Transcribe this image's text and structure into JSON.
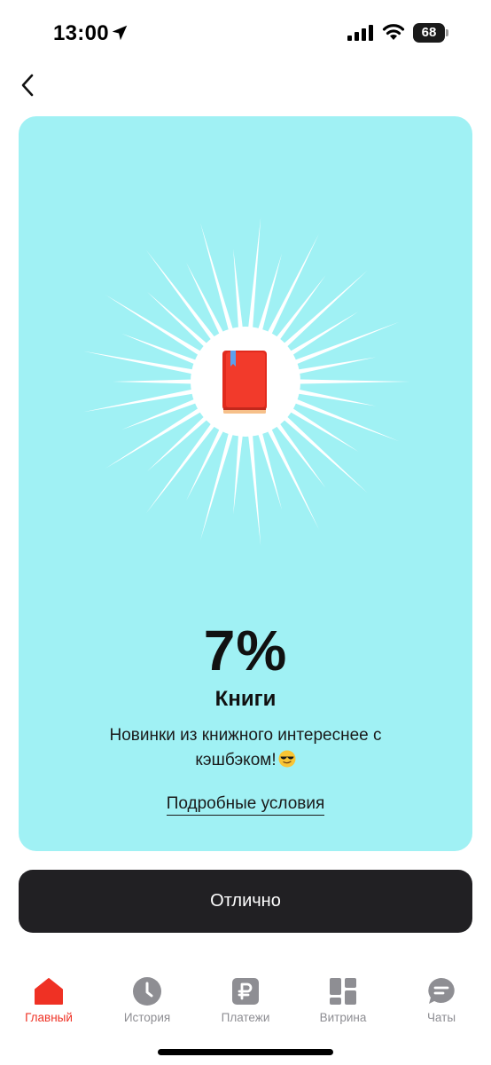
{
  "status_bar": {
    "time": "13:00",
    "battery": "68",
    "icons": [
      "location-arrow-icon",
      "signal-icon",
      "wifi-icon",
      "battery-icon"
    ]
  },
  "nav": {
    "back_icon": "chevron-left-icon"
  },
  "offer": {
    "icon": "red-book-icon",
    "percent": "7%",
    "category": "Книги",
    "description": "Новинки из книжного интереснее с кэшбэком!",
    "description_emoji": "smiling-face-with-sunglasses",
    "terms_link": "Подробные условия",
    "background_color": "#a0f1f4"
  },
  "primary_button": {
    "label": "Отлично",
    "color": "#212023"
  },
  "tab_bar": {
    "active_color": "#ef3124",
    "inactive_color": "#8e8e93",
    "tabs": [
      {
        "label": "Главный",
        "icon": "home-icon",
        "active": true
      },
      {
        "label": "История",
        "icon": "clock-icon",
        "active": false
      },
      {
        "label": "Платежи",
        "icon": "ruble-icon",
        "active": false
      },
      {
        "label": "Витрина",
        "icon": "showcase-icon",
        "active": false
      },
      {
        "label": "Чаты",
        "icon": "chat-icon",
        "active": false
      }
    ]
  }
}
